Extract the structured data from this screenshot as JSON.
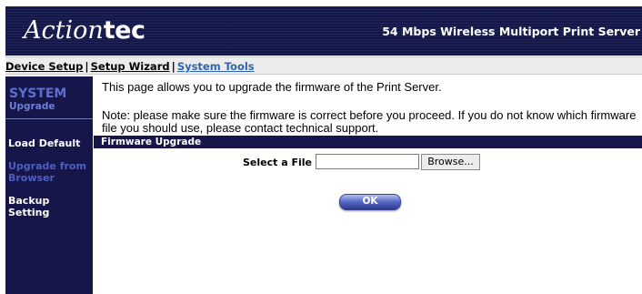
{
  "header": {
    "logo_script": "Action",
    "logo_bold": "tec",
    "product_title": "54 Mbps Wireless Multiport Print Server"
  },
  "nav": {
    "device_setup": "Device Setup",
    "setup_wizard": "Setup Wizard",
    "system_tools": "System Tools",
    "separator": "|",
    "active": "System Tools"
  },
  "sidebar": {
    "title": "SYSTEM",
    "subtitle": "Upgrade",
    "items": [
      {
        "label": "Load Default",
        "active": false
      },
      {
        "label": "Upgrade from Browser",
        "active": true
      },
      {
        "label": "Backup Setting",
        "active": false
      }
    ]
  },
  "main": {
    "intro": "This page allows you to upgrade the firmware of the Print Server.",
    "note": "Note: please make sure the firmware is correct before you proceed. If you do not know which firmware file you should use, please contact technical support.",
    "section_title": "Firmware Upgrade",
    "file_label": "Select a File :",
    "file_value": "",
    "browse_label": "Browse...",
    "ok_label": "OK"
  },
  "colors": {
    "banner": "#14174a",
    "sidebar": "#16164a",
    "active_link": "#2f63b5",
    "sidebar_title": "#5a6fd0"
  }
}
